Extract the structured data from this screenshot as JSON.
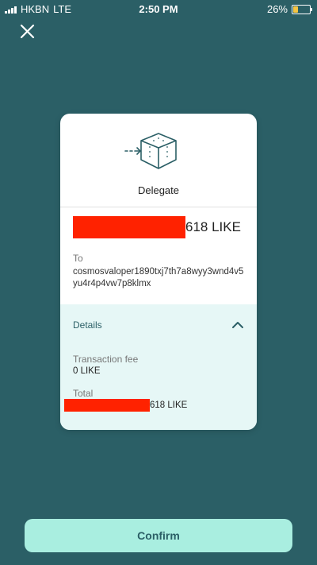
{
  "status_bar": {
    "carrier": "HKBN",
    "network": "LTE",
    "time": "2:50 PM",
    "battery_percent": "26%",
    "battery_level": 0.26
  },
  "icons": {
    "close": "close-icon",
    "delegate": "delegate-box-icon",
    "collapse": "chevron-up-icon"
  },
  "card": {
    "action": "Delegate",
    "amount_suffix": "618 LIKE",
    "to_label": "To",
    "to_address": "cosmosvaloper1890txj7th7a8wyy3wnd4v5yu4r4p4vw7p8klmx"
  },
  "details": {
    "title": "Details",
    "fee_label": "Transaction fee",
    "fee_value": "0 LIKE",
    "total_label": "Total",
    "total_suffix": "618 LIKE"
  },
  "confirm_label": "Confirm",
  "colors": {
    "background": "#2b5f66",
    "button": "#a9eee0",
    "details_bg": "#e6f7f6",
    "redaction": "#ff2200"
  }
}
